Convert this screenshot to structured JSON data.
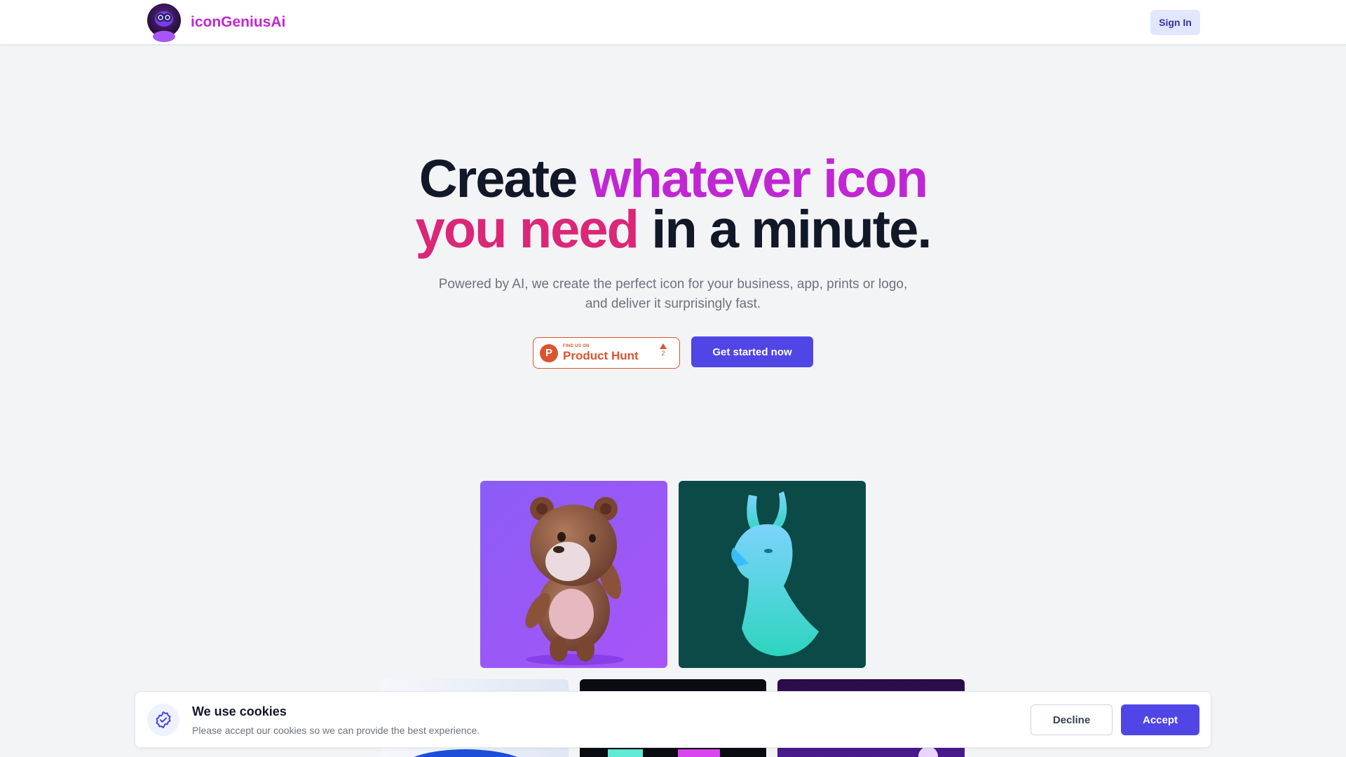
{
  "header": {
    "brand": "iconGeniusAi",
    "signin_label": "Sign In"
  },
  "hero": {
    "title_part1": "Create ",
    "title_part2": "whatever icon",
    "title_part3": "you need",
    "title_part4": " in a minute.",
    "subtitle": "Powered by AI, we create the perfect icon for your business, app, prints or logo, and deliver it surprisingly fast.",
    "producthunt": {
      "small": "FIND US ON",
      "big": "Product Hunt",
      "votes": "2",
      "logo_letter": "P"
    },
    "cta_label": "Get started now"
  },
  "gallery": {
    "tiles": [
      {
        "icon": "teddy-bear-icon",
        "bg": "#9b5cf6"
      },
      {
        "icon": "llama-icon",
        "bg": "#0b4a46"
      },
      {
        "icon": "blue-creature-icon",
        "bg": "#e8eef8"
      },
      {
        "icon": "neon-icon",
        "bg": "#0b0b12"
      },
      {
        "icon": "purple-monster-icon",
        "bg": "#2a0a45"
      }
    ]
  },
  "cookie": {
    "title": "We use cookies",
    "text": "Please accept our cookies so we can provide the best experience.",
    "decline_label": "Decline",
    "accept_label": "Accept"
  },
  "colors": {
    "brand": "#c026d3",
    "accent": "#4f46e5",
    "pink": "#db2777",
    "producthunt": "#da552f"
  }
}
